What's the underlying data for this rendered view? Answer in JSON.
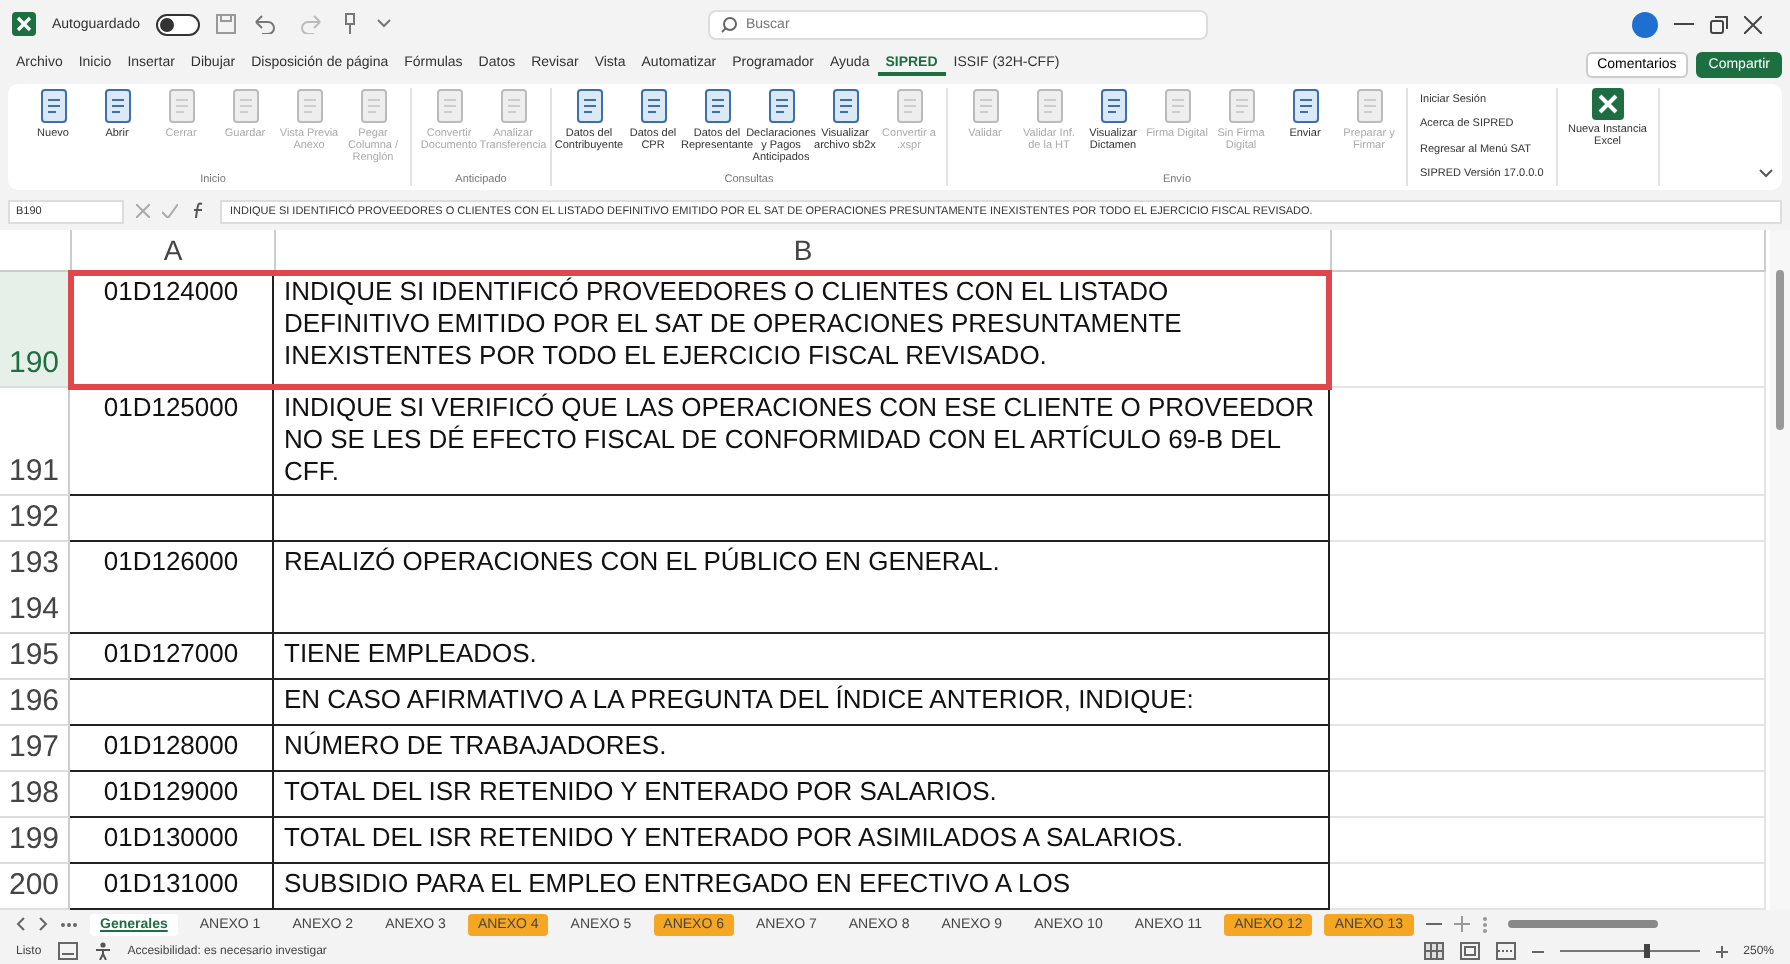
{
  "title_bar": {
    "autosave_label": "Autoguardado",
    "autosave_on": false,
    "search": {
      "placeholder": "Buscar"
    }
  },
  "menu_tabs": [
    {
      "label": "Archivo",
      "selected": false
    },
    {
      "label": "Inicio",
      "selected": false
    },
    {
      "label": "Insertar",
      "selected": false
    },
    {
      "label": "Dibujar",
      "selected": false
    },
    {
      "label": "Disposición de página",
      "selected": false
    },
    {
      "label": "Fórmulas",
      "selected": false
    },
    {
      "label": "Datos",
      "selected": false
    },
    {
      "label": "Revisar",
      "selected": false
    },
    {
      "label": "Vista",
      "selected": false
    },
    {
      "label": "Automatizar",
      "selected": false
    },
    {
      "label": "Programador",
      "selected": false
    },
    {
      "label": "Ayuda",
      "selected": false
    },
    {
      "label": "SIPRED",
      "selected": true
    },
    {
      "label": "ISSIF (32H-CFF)",
      "selected": false
    }
  ],
  "header_buttons": {
    "comments": "Comentarios",
    "share": "Compartir"
  },
  "ribbon_groups": [
    {
      "label": "Inicio",
      "items": [
        {
          "label": "Nuevo",
          "disabled": false
        },
        {
          "label": "Abrir",
          "disabled": false
        },
        {
          "label": "Cerrar",
          "disabled": true
        },
        {
          "label": "Guardar",
          "disabled": true
        },
        {
          "label": "Vista Previa Anexo",
          "disabled": true
        },
        {
          "label": "Pegar Columna / Renglón",
          "disabled": true
        }
      ]
    },
    {
      "label": "Anticipado",
      "items": [
        {
          "label": "Convertir Documento",
          "disabled": true
        },
        {
          "label": "Analizar Transferencia",
          "disabled": true
        }
      ]
    },
    {
      "label": "Consultas",
      "items": [
        {
          "label": "Datos del Contribuyente",
          "disabled": false
        },
        {
          "label": "Datos del CPR",
          "disabled": false
        },
        {
          "label": "Datos del Representante",
          "disabled": false
        },
        {
          "label": "Declaraciones y Pagos Anticipados",
          "disabled": false
        },
        {
          "label": "Visualizar archivo sb2x",
          "disabled": false
        },
        {
          "label": "Convertir a .xspr",
          "disabled": true
        }
      ]
    },
    {
      "label": "Envío",
      "items": [
        {
          "label": "Validar",
          "disabled": true
        },
        {
          "label": "Validar Inf. de la HT",
          "disabled": true
        },
        {
          "label": "Visualizar Dictamen",
          "disabled": false
        },
        {
          "label": "Firma Digital",
          "disabled": true
        },
        {
          "label": "Sin Firma Digital",
          "disabled": true
        },
        {
          "label": "Enviar",
          "disabled": false
        },
        {
          "label": "Preparar y Firmar",
          "disabled": true
        }
      ]
    }
  ],
  "ribbon_links": [
    "Iniciar Sesión",
    "Acerca de SIPRED",
    "Regresar al Menú SAT",
    "SIPRED Versión 17.0.0.0"
  ],
  "new_instance": "Nueva Instancia Excel",
  "formula_bar": {
    "name_box": "B190",
    "formula": "INDIQUE SI IDENTIFICÓ PROVEEDORES O CLIENTES CON EL LISTADO DEFINITIVO EMITIDO POR EL SAT DE OPERACIONES PRESUNTAMENTE INEXISTENTES POR TODO EL EJERCICIO FISCAL REVISADO."
  },
  "columns": [
    "A",
    "B"
  ],
  "rows": [
    {
      "numbers": [
        "190"
      ],
      "selected": true,
      "highlighted": true,
      "a": "01D124000",
      "b": "INDIQUE SI IDENTIFICÓ PROVEEDORES O CLIENTES CON EL LISTADO DEFINITIVO EMITIDO POR EL SAT DE OPERACIONES PRESUNTAMENTE INEXISTENTES POR TODO EL EJERCICIO FISCAL REVISADO."
    },
    {
      "numbers": [
        "191"
      ],
      "selected": false,
      "highlighted": false,
      "a": "01D125000",
      "b": "INDIQUE SI VERIFICÓ QUE LAS OPERACIONES CON ESE CLIENTE O PROVEEDOR NO SE LES DÉ EFECTO FISCAL DE CONFORMIDAD CON EL ARTÍCULO 69-B DEL CFF."
    },
    {
      "numbers": [
        "192"
      ],
      "selected": false,
      "highlighted": false
    },
    {
      "numbers": [
        "193",
        "194"
      ],
      "selected": false,
      "highlighted": false,
      "a": "01D126000",
      "b": "REALIZÓ OPERACIONES CON EL PÚBLICO EN GENERAL."
    },
    {
      "numbers": [
        "195"
      ],
      "selected": false,
      "highlighted": false,
      "a": "01D127000",
      "b": "TIENE EMPLEADOS."
    },
    {
      "numbers": [
        "196"
      ],
      "selected": false,
      "highlighted": false,
      "b": "EN CASO AFIRMATIVO A LA PREGUNTA DEL ÍNDICE ANTERIOR, INDIQUE:"
    },
    {
      "numbers": [
        "197"
      ],
      "selected": false,
      "highlighted": false,
      "a": "01D128000",
      "b": "NÚMERO DE TRABAJADORES."
    },
    {
      "numbers": [
        "198"
      ],
      "selected": false,
      "highlighted": false,
      "a": "01D129000",
      "b": "TOTAL DEL ISR RETENIDO Y ENTERADO POR SALARIOS."
    },
    {
      "numbers": [
        "199"
      ],
      "selected": false,
      "highlighted": false,
      "a": "01D130000",
      "b": "TOTAL DEL ISR RETENIDO Y ENTERADO POR ASIMILADOS A SALARIOS."
    },
    {
      "numbers": [
        "200"
      ],
      "selected": false,
      "highlighted": false,
      "a": "01D131000",
      "b": "SUBSIDIO PARA EL EMPLEO ENTREGADO EN EFECTIVO A LOS"
    }
  ],
  "sheet_tabs": [
    {
      "label": "Generales",
      "selected": true
    },
    {
      "label": "ANEXO 1",
      "selected": false
    },
    {
      "label": "ANEXO 2",
      "selected": false
    },
    {
      "label": "ANEXO 3",
      "selected": false
    },
    {
      "label": "ANEXO 4",
      "selected": false,
      "color": "#f5a623"
    },
    {
      "label": "ANEXO 5",
      "selected": false
    },
    {
      "label": "ANEXO 6",
      "selected": false,
      "color": "#f5a623"
    },
    {
      "label": "ANEXO 7",
      "selected": false
    },
    {
      "label": "ANEXO 8",
      "selected": false
    },
    {
      "label": "ANEXO 9",
      "selected": false
    },
    {
      "label": "ANEXO 10",
      "selected": false
    },
    {
      "label": "ANEXO 11",
      "selected": false
    },
    {
      "label": "ANEXO 12",
      "selected": false,
      "color": "#f5a623"
    },
    {
      "label": "ANEXO 13",
      "selected": false,
      "color": "#f5a623"
    }
  ],
  "status_bar": {
    "mode": "Listo",
    "accessibility": "Accesibilidad: es necesario investigar",
    "zoom": "250%",
    "zoom_slider": {
      "level": 0.62
    }
  }
}
